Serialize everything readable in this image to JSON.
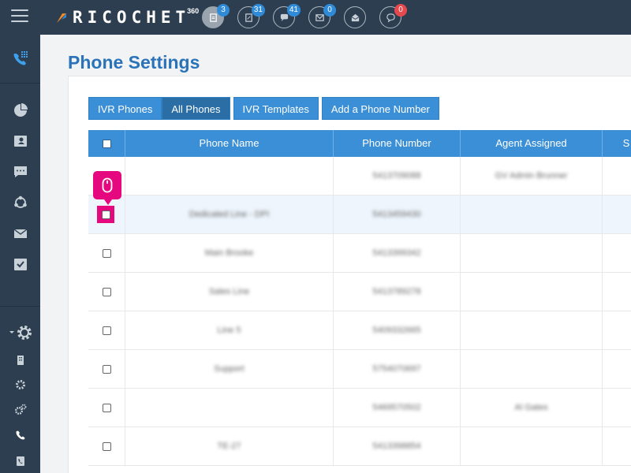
{
  "brand": {
    "name": "RICOCHET",
    "sup": "360"
  },
  "topbar": {
    "icons": [
      {
        "icon": "document-icon",
        "badge": "3",
        "badge_color": "#2f8bd8"
      },
      {
        "icon": "form-icon",
        "badge": "31",
        "badge_color": "#2f8bd8"
      },
      {
        "icon": "chat-icon",
        "badge": "41",
        "badge_color": "#2f8bd8"
      },
      {
        "icon": "mail-icon",
        "badge": "0",
        "badge_color": "#2f8bd8"
      },
      {
        "icon": "mail-open-icon",
        "badge": "",
        "badge_color": ""
      },
      {
        "icon": "comment-icon",
        "badge": "0",
        "badge_color": "#e5484d"
      }
    ]
  },
  "sidebar": {
    "items": [
      "phone-dialpad-icon",
      "pie-chart-icon",
      "contacts-icon",
      "sms-icon",
      "network-icon",
      "envelope-icon",
      "checklist-icon",
      "settings-gear-icon",
      "building-icon",
      "gear-icon",
      "gears-icon",
      "phone-icon",
      "phone-book-icon"
    ]
  },
  "page": {
    "title": "Phone Settings"
  },
  "tabs": [
    {
      "label": "IVR Phones",
      "active": false
    },
    {
      "label": "All Phones",
      "active": true
    },
    {
      "label": "IVR Templates",
      "active": false
    },
    {
      "label": "Add a Phone Number",
      "active": false
    }
  ],
  "table": {
    "columns": [
      "",
      "Phone Name",
      "Phone Number",
      "Agent Assigned",
      "S"
    ],
    "rows": [
      {
        "name": "",
        "number": "5413709088",
        "agent": "GV Admin Brunner"
      },
      {
        "name": "Dedicated Line - DPI",
        "number": "5413459430",
        "agent": ""
      },
      {
        "name": "Main Brooke",
        "number": "5413399342",
        "agent": ""
      },
      {
        "name": "Sales Line",
        "number": "5413789278",
        "agent": ""
      },
      {
        "name": "Line 5",
        "number": "5409332665",
        "agent": ""
      },
      {
        "name": "Support",
        "number": "5754070697",
        "agent": ""
      },
      {
        "name": "",
        "number": "5469570502",
        "agent": "Al Gates"
      },
      {
        "name": "TE-27",
        "number": "5413398854",
        "agent": ""
      }
    ]
  },
  "colors": {
    "accent": "#3a8fd6",
    "highlight": "#e5087e",
    "nav": "#2d3e50"
  }
}
